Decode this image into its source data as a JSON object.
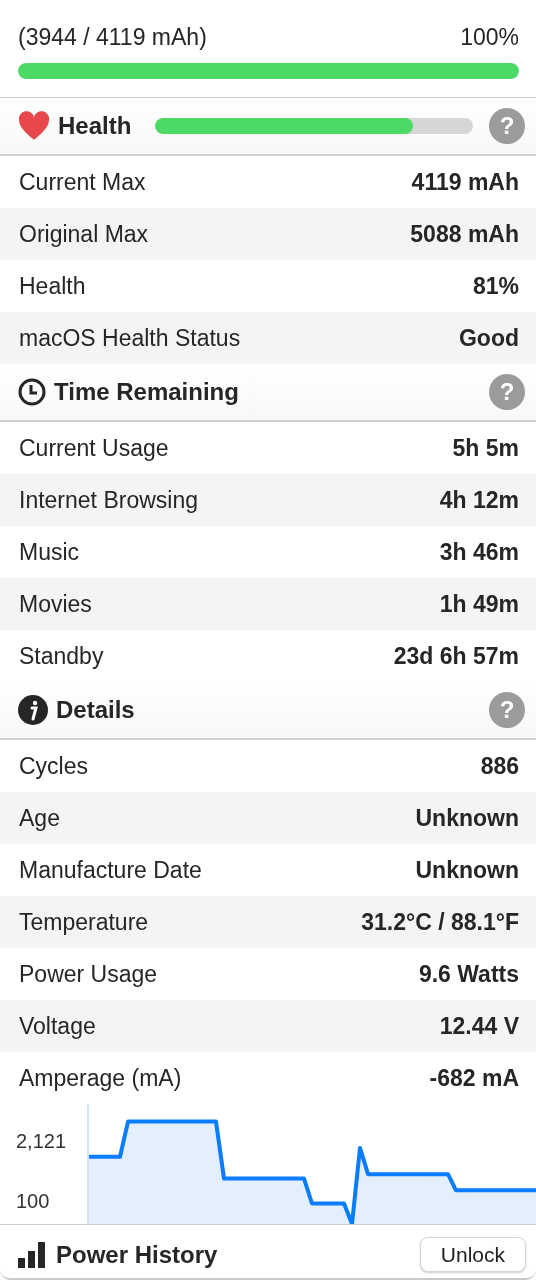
{
  "charge": {
    "reading": "(3944 / 4119 mAh)",
    "percent": "100%",
    "level": 1
  },
  "sections": [
    {
      "kind": "health",
      "title": "Health",
      "help": "?",
      "level": 0.81,
      "rows": [
        {
          "label": "Current Max",
          "value": "4119 mAh"
        },
        {
          "label": "Original Max",
          "value": "5088 mAh"
        },
        {
          "label": "Health",
          "value": "81%"
        },
        {
          "label": "macOS Health Status",
          "value": "Good"
        }
      ]
    },
    {
      "kind": "time",
      "title": "Time Remaining",
      "help": "?",
      "rows": [
        {
          "label": "Current Usage",
          "value": "5h 5m"
        },
        {
          "label": "Internet Browsing",
          "value": "4h 12m"
        },
        {
          "label": "Music",
          "value": "3h 46m"
        },
        {
          "label": "Movies",
          "value": "1h 49m"
        },
        {
          "label": "Standby",
          "value": "23d 6h 57m"
        }
      ]
    },
    {
      "kind": "details",
      "title": "Details",
      "help": "?",
      "rows": [
        {
          "label": "Cycles",
          "value": "886"
        },
        {
          "label": "Age",
          "value": "Unknown"
        },
        {
          "label": "Manufacture Date",
          "value": "Unknown"
        },
        {
          "label": "Temperature",
          "value": "31.2°C / 88.1°F"
        },
        {
          "label": "Power Usage",
          "value": "9.6 Watts"
        },
        {
          "label": "Voltage",
          "value": "12.44 V"
        },
        {
          "label": "Amperage (mA)",
          "value": "-682 mA"
        }
      ]
    }
  ],
  "amperage_chart": {
    "chart_data": {
      "type": "area",
      "categories": [
        null,
        null,
        null,
        null,
        null,
        null,
        null,
        null,
        null,
        null,
        null,
        null,
        null,
        null,
        null,
        null,
        null,
        null,
        null,
        null,
        null,
        null,
        null,
        null,
        null,
        null,
        null,
        null,
        null,
        null,
        null,
        null,
        null,
        null,
        null,
        null,
        null,
        null,
        null,
        null,
        null,
        null,
        null,
        null,
        null,
        null,
        null,
        null,
        null,
        null,
        null,
        null,
        null,
        null,
        null,
        null,
        null
      ],
      "series": [
        {
          "color": "#0a7cff",
          "values": [
            1600,
            1600,
            1600,
            1600,
            1600,
            2800,
            2800,
            2800,
            2800,
            2800,
            2800,
            2800,
            2800,
            2800,
            2800,
            2800,
            2800,
            850,
            850,
            850,
            850,
            850,
            850,
            850,
            850,
            850,
            850,
            850,
            0,
            0,
            0,
            0,
            0,
            -700,
            1900,
            1000,
            1000,
            1000,
            1000,
            1000,
            1000,
            1000,
            1000,
            1000,
            1000,
            1000,
            450,
            450,
            450,
            450,
            450,
            450,
            450,
            450,
            450,
            450,
            450
          ]
        }
      ],
      "ylim": [
        -700,
        3400
      ],
      "yticks": [
        {
          "value": 2121,
          "label": "2,121"
        },
        {
          "value": 100,
          "label": "100"
        }
      ]
    }
  },
  "footer": {
    "title": "Power History",
    "button": "Unlock"
  }
}
